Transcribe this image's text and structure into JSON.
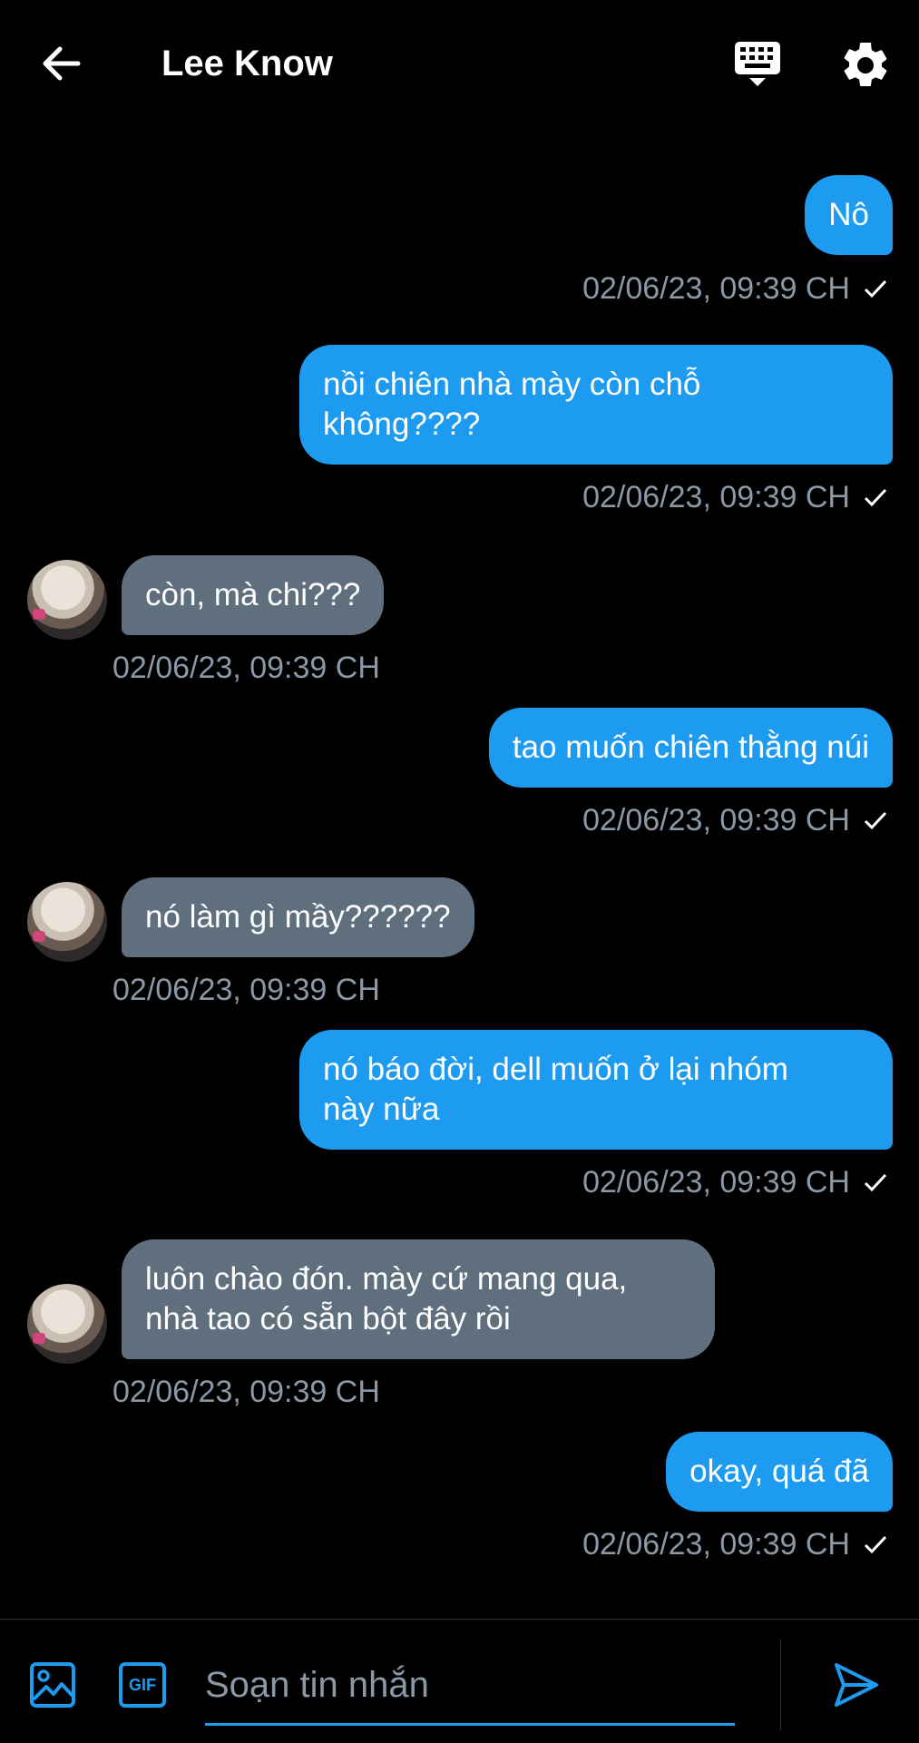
{
  "header": {
    "title": "Lee Know"
  },
  "messages": [
    {
      "direction": "out",
      "text": "Nô",
      "timestamp": "02/06/23, 09:39 CH"
    },
    {
      "direction": "out",
      "text": "nồi chiên nhà mày còn chỗ\nkhông????",
      "timestamp": "02/06/23, 09:39 CH"
    },
    {
      "direction": "in",
      "text": "còn, mà chi???",
      "timestamp": "02/06/23, 09:39 CH"
    },
    {
      "direction": "out",
      "text": "tao muốn chiên thằng núi",
      "timestamp": "02/06/23, 09:39 CH"
    },
    {
      "direction": "in",
      "text": "nó làm gì mầy??????",
      "timestamp": "02/06/23, 09:39 CH"
    },
    {
      "direction": "out",
      "text": "nó báo đời, dell muốn ở lại nhóm\nnày nữa",
      "timestamp": "02/06/23, 09:39 CH"
    },
    {
      "direction": "in",
      "text": "luôn chào đón. mày cứ mang qua,\nnhà tao có sẵn bột đây rồi",
      "timestamp": "02/06/23, 09:39 CH"
    },
    {
      "direction": "out",
      "text": "okay, quá đã",
      "timestamp": "02/06/23, 09:39 CH"
    }
  ],
  "composer": {
    "placeholder": "Soạn tin nhắn",
    "gif_label": "GIF"
  },
  "colors": {
    "accent": "#1d9bf0",
    "incoming_bubble": "#5f6f7e",
    "timestamp": "#8b98a5",
    "background": "#000000"
  }
}
